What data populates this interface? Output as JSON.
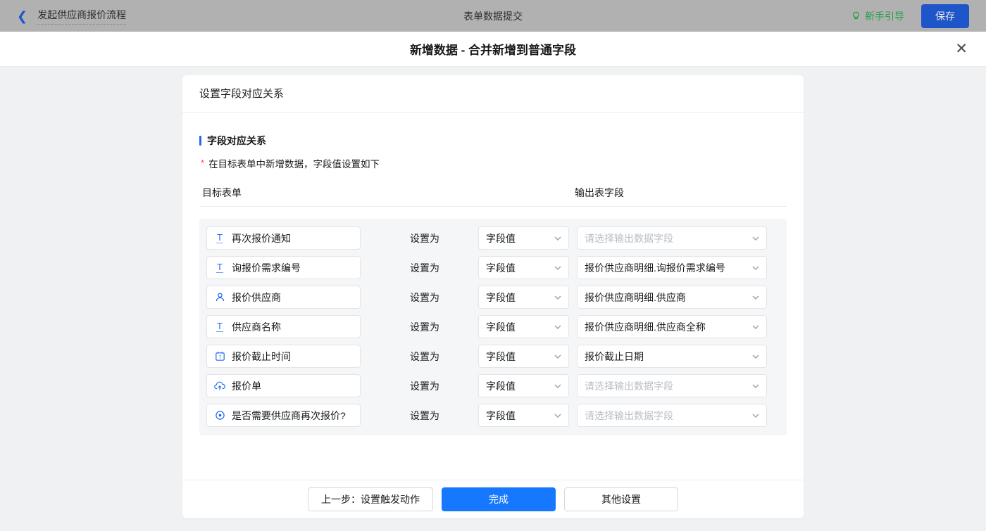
{
  "topbar": {
    "back_label": "发起供应商报价流程",
    "center_title": "表单数据提交",
    "guide_label": "新手引导",
    "save_label": "保存"
  },
  "modal": {
    "title": "新增数据 - 合并新增到普通字段",
    "close_glyph": "✕"
  },
  "panel": {
    "header": "设置字段对应关系",
    "section_title": "字段对应关系",
    "note_star": "*",
    "note": "在目标表单中新增数据，字段值设置如下",
    "col_target": "目标表单",
    "col_output": "输出表字段",
    "set_as_label": "设置为",
    "value_type_label": "字段值",
    "output_placeholder": "请选择输出数据字段",
    "rows": [
      {
        "icon": "text-field-icon",
        "field": "再次报价通知",
        "value_type": "字段值",
        "output": "请选择输出数据字段"
      },
      {
        "icon": "text-field-icon",
        "field": "询报价需求编号",
        "value_type": "字段值",
        "output": "报价供应商明细.询报价需求编号"
      },
      {
        "icon": "person-icon",
        "field": "报价供应商",
        "value_type": "字段值",
        "output": "报价供应商明细.供应商"
      },
      {
        "icon": "text-field-icon",
        "field": "供应商名称",
        "value_type": "字段值",
        "output": "报价供应商明细.供应商全称"
      },
      {
        "icon": "calendar-icon",
        "field": "报价截止时间",
        "value_type": "字段值",
        "output": "报价截止日期"
      },
      {
        "icon": "upload-cloud-icon",
        "field": "报价单",
        "value_type": "字段值",
        "output": "请选择输出数据字段"
      },
      {
        "icon": "radio-icon",
        "field": "是否需要供应商再次报价?",
        "value_type": "字段值",
        "output": "请选择输出数据字段"
      }
    ]
  },
  "footer": {
    "prev_label": "上一步：设置触发动作",
    "done_label": "完成",
    "other_label": "其他设置"
  },
  "colors": {
    "accent_blue": "#2468f2",
    "primary_button_blue": "#1677ff",
    "dimmed_save_blue": "#1e55c8",
    "guide_green": "#2b9e4a",
    "required_red": "#f54a45",
    "topbar_dimmed_gray": "#b1b1b1",
    "panel_gray": "#f5f6f7"
  }
}
